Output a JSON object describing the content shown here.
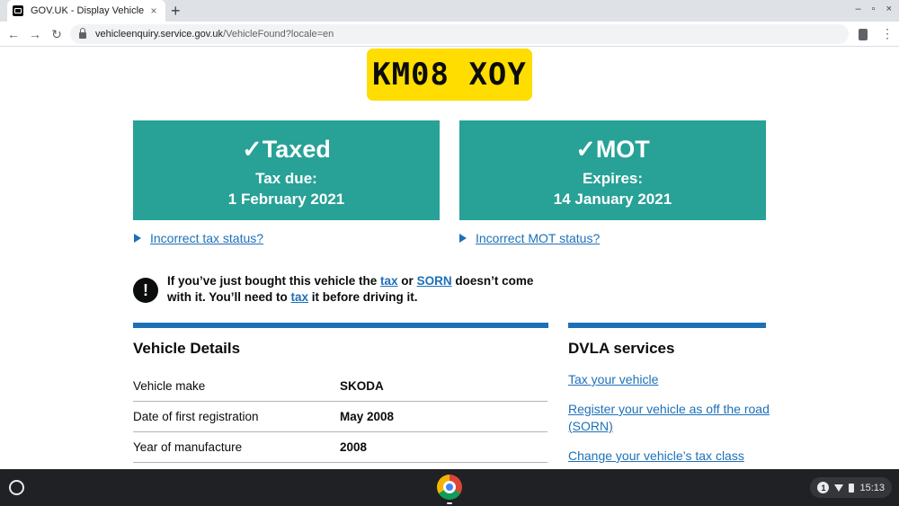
{
  "browser": {
    "tab_title": "GOV.UK - Display Vehicle",
    "tab_close": "×",
    "new_tab": "+",
    "win_minimize": "–",
    "win_restore": "▫",
    "win_close": "×",
    "back": "←",
    "forward": "→",
    "reload": "↻",
    "url_host": "vehicleenquiry.service.gov.uk",
    "url_path": "/VehicleFound?locale=en",
    "menu": "⋮"
  },
  "vehicle": {
    "registration": "KM08 XOY"
  },
  "tax_panel": {
    "tick": "✓",
    "title": "Taxed",
    "label": "Tax due:",
    "date": "1 February 2021",
    "link": "Incorrect tax status?"
  },
  "mot_panel": {
    "tick": "✓",
    "title": "MOT",
    "label": "Expires:",
    "date": "14 January 2021",
    "link": "Incorrect MOT status?"
  },
  "warning": {
    "icon": "!",
    "part1": "If you’ve just bought this vehicle the ",
    "link_tax1": "tax",
    "part2": " or ",
    "link_sorn": "SORN",
    "part3": " doesn’t come with it. You’ll need to ",
    "link_tax2": "tax",
    "part4": " it before driving it."
  },
  "vehicle_details": {
    "title": "Vehicle Details",
    "rows": [
      {
        "key": "Vehicle make",
        "value": "SKODA"
      },
      {
        "key": "Date of first registration",
        "value": "May 2008"
      },
      {
        "key": "Year of manufacture",
        "value": "2008"
      }
    ]
  },
  "dvla_services": {
    "title": "DVLA services",
    "links": [
      "Tax your vehicle",
      "Register your vehicle as off the road (SORN)",
      "Change your vehicle’s tax class"
    ]
  },
  "shelf": {
    "notification_count": "1",
    "time": "15:13"
  },
  "colors": {
    "status_green": "#28a197",
    "link_blue": "#1d70b8",
    "plate_yellow": "#ffdd00"
  }
}
